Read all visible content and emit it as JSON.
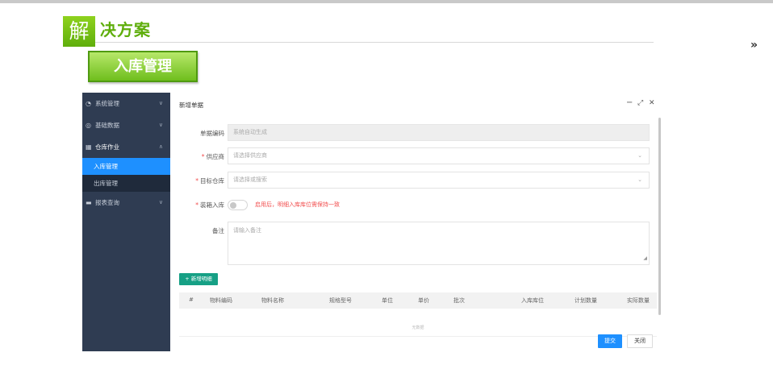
{
  "banner": {
    "big_char": "解",
    "rest": "决方案",
    "sub_title": "入库管理",
    "page_arrow": "»"
  },
  "sidebar": {
    "items": [
      {
        "label": "系统管理",
        "icon": "gauge-icon",
        "caret": "∨"
      },
      {
        "label": "基础数据",
        "icon": "circle-icon",
        "caret": "∨"
      },
      {
        "label": "仓库作业",
        "icon": "warehouse-icon",
        "caret": "∧"
      },
      {
        "label": "报表查询",
        "icon": "report-icon",
        "caret": "∨"
      }
    ],
    "sub_items": [
      "入库管理",
      "出库管理"
    ]
  },
  "dialog": {
    "title": "新增单据",
    "minimize": "−",
    "maximize": "⤢",
    "close": "✕",
    "fields": {
      "doc_code": {
        "label": "单据编码",
        "value": "系统自动生成"
      },
      "supplier": {
        "label": "供应商",
        "placeholder": "请选择供应商"
      },
      "target_wh": {
        "label": "目标仓库",
        "placeholder": "请选择或搜索"
      },
      "box_in": {
        "label": "装箱入库",
        "hint": "启用后，明细入库库位需保持一致"
      },
      "remark": {
        "label": "备注",
        "placeholder": "请输入备注"
      }
    },
    "add_button": "+ 新增明细",
    "grid_columns": [
      "#",
      "物料编码",
      "物料名称",
      "规格型号",
      "单位",
      "单价",
      "批次",
      "入库库位",
      "计划数量",
      "实际数量"
    ],
    "no_data": "无数据",
    "submit": "提交",
    "close_btn": "关闭"
  },
  "colors": {
    "accent_green": "#5fae0c",
    "sidebar_bg": "#2f3c52",
    "primary_blue": "#1e90ff",
    "teal_button": "#16a085",
    "required_red": "#f24e4e"
  }
}
